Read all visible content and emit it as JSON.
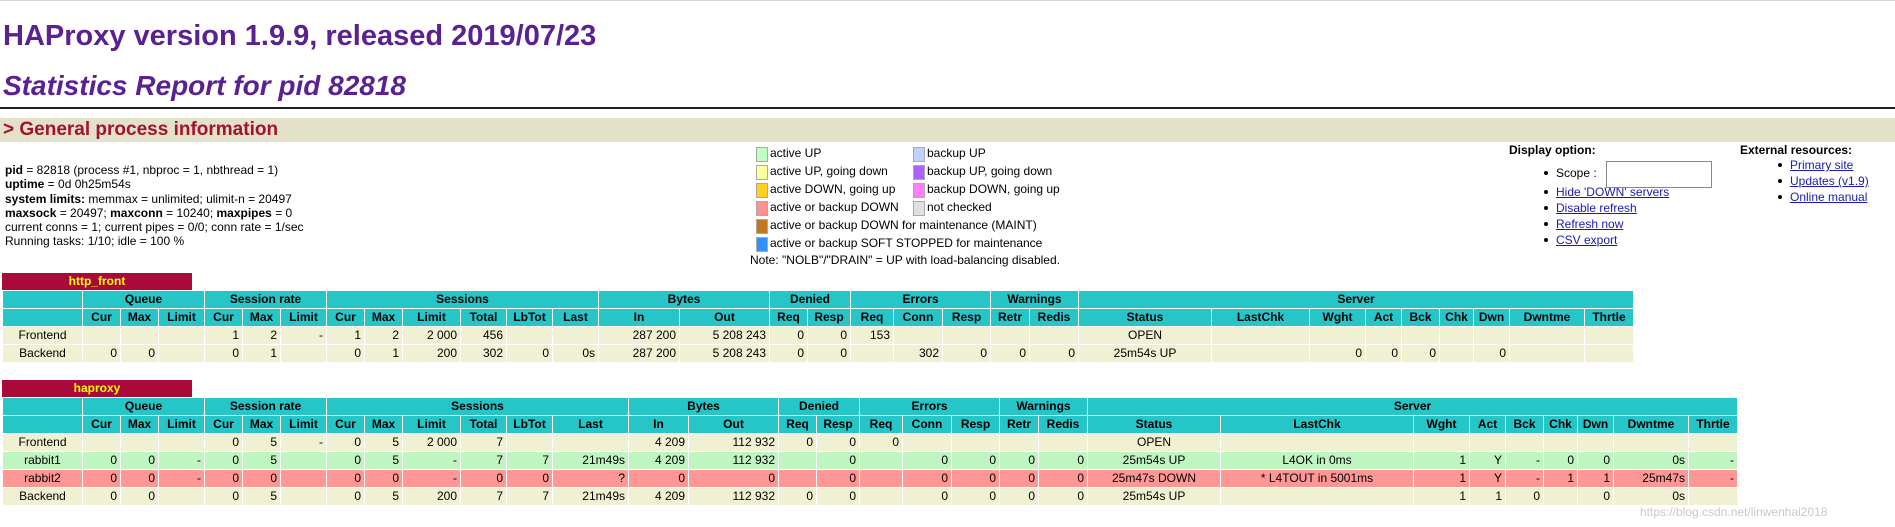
{
  "header": {
    "title": "HAProxy version 1.9.9, released 2019/07/23",
    "subtitle": "Statistics Report for pid 82818"
  },
  "section": {
    "title": "> General process information"
  },
  "info": {
    "line1_label": "pid",
    "line1_value": " = 82818 (process #1, nbproc = 1, nbthread = 1)",
    "line2_label": "uptime",
    "line2_value": " = 0d 0h25m54s",
    "line3_label": "system limits:",
    "line3_value": " memmax = unlimited; ulimit-n = 20497",
    "line4_label_a": "maxsock",
    "line4_value_a": " = 20497; ",
    "line4_label_b": "maxconn",
    "line4_value_b": " = 10240; ",
    "line4_label_c": "maxpipes",
    "line4_value_c": " = 0",
    "line5": "current conns = 1; current pipes = 0/0; conn rate = 1/sec",
    "line6": "Running tasks: 1/10; idle = 100 %"
  },
  "legend": {
    "items": [
      {
        "label": "active UP",
        "color": "#c0ffc0"
      },
      {
        "label": "active UP, going down",
        "color": "#ffffa0"
      },
      {
        "label": "active DOWN, going up",
        "color": "#ffd020"
      },
      {
        "label": "active or backup DOWN",
        "color": "#ff9090"
      },
      {
        "label": "active or backup DOWN for maintenance (MAINT)",
        "color": "#c07820"
      },
      {
        "label": "active or backup SOFT STOPPED for maintenance",
        "color": "#3090ff"
      },
      {
        "label": "backup UP",
        "color": "#c0d0ff"
      },
      {
        "label": "backup UP, going down",
        "color": "#b060ff"
      },
      {
        "label": "backup DOWN, going up",
        "color": "#ff80ff"
      },
      {
        "label": "not checked",
        "color": "#e0e0e0"
      }
    ],
    "note": "Note: \"NOLB\"/\"DRAIN\" = UP with load-balancing disabled."
  },
  "display": {
    "title": "Display option:",
    "scope_label": "Scope :",
    "links": [
      "Hide 'DOWN' servers",
      "Disable refresh",
      "Refresh now",
      "CSV export"
    ]
  },
  "external": {
    "title": "External resources:",
    "links": [
      "Primary site",
      "Updates (v1.9)",
      "Online manual"
    ]
  },
  "headers": {
    "groups": [
      "Queue",
      "Session rate",
      "Sessions",
      "Bytes",
      "Denied",
      "Errors",
      "Warnings",
      "Server"
    ],
    "cols": [
      "Cur",
      "Max",
      "Limit",
      "Cur",
      "Max",
      "Limit",
      "Cur",
      "Max",
      "Limit",
      "Total",
      "LbTot",
      "Last",
      "In",
      "Out",
      "Req",
      "Resp",
      "Req",
      "Conn",
      "Resp",
      "Retr",
      "Redis",
      "Status",
      "LastChk",
      "Wght",
      "Act",
      "Bck",
      "Chk",
      "Dwn",
      "Dwntme",
      "Thrtle"
    ]
  },
  "http_front": {
    "name": "http_front",
    "rows": [
      {
        "kind": "frontend",
        "cells": [
          "Frontend",
          "",
          "",
          "",
          "1",
          "2",
          "-",
          "1",
          "2",
          "2 000",
          "456",
          "",
          "",
          "287 200",
          "5 208 243",
          "0",
          "0",
          "153",
          "",
          "",
          "",
          "",
          "OPEN",
          "",
          "",
          "",
          "",
          "",
          "",
          "",
          ""
        ]
      },
      {
        "kind": "backend",
        "cells": [
          "Backend",
          "0",
          "0",
          "",
          "0",
          "1",
          "",
          "0",
          "1",
          "200",
          "302",
          "0",
          "0s",
          "287 200",
          "5 208 243",
          "0",
          "0",
          "",
          "302",
          "0",
          "0",
          "0",
          "25m54s UP",
          "",
          "0",
          "0",
          "0",
          "",
          "0",
          "",
          ""
        ]
      }
    ]
  },
  "haproxy": {
    "name": "haproxy",
    "rows": [
      {
        "kind": "frontend",
        "cells": [
          "Frontend",
          "",
          "",
          "",
          "0",
          "5",
          "-",
          "0",
          "5",
          "2 000",
          "7",
          "",
          "",
          "4 209",
          "112 932",
          "0",
          "0",
          "0",
          "",
          "",
          "",
          "",
          "OPEN",
          "",
          "",
          "",
          "",
          "",
          "",
          "",
          ""
        ]
      },
      {
        "kind": "up",
        "cells": [
          "rabbit1",
          "0",
          "0",
          "-",
          "0",
          "5",
          "",
          "0",
          "5",
          "-",
          "7",
          "7",
          "21m49s",
          "4 209",
          "112 932",
          "",
          "0",
          "",
          "0",
          "0",
          "0",
          "0",
          "25m54s UP",
          "L4OK in 0ms",
          "1",
          "Y",
          "-",
          "0",
          "0",
          "0s",
          "-"
        ]
      },
      {
        "kind": "down",
        "cells": [
          "rabbit2",
          "0",
          "0",
          "-",
          "0",
          "0",
          "",
          "0",
          "0",
          "-",
          "0",
          "0",
          "?",
          "0",
          "0",
          "",
          "0",
          "",
          "0",
          "0",
          "0",
          "0",
          "25m47s DOWN",
          "* L4TOUT in 5001ms",
          "1",
          "Y",
          "-",
          "1",
          "1",
          "25m47s",
          "-"
        ]
      },
      {
        "kind": "backend",
        "cells": [
          "Backend",
          "0",
          "0",
          "",
          "0",
          "5",
          "",
          "0",
          "5",
          "200",
          "7",
          "7",
          "21m49s",
          "4 209",
          "112 932",
          "0",
          "0",
          "",
          "0",
          "0",
          "0",
          "0",
          "25m54s UP",
          "",
          "1",
          "1",
          "0",
          "",
          "0",
          "0s",
          ""
        ]
      }
    ]
  },
  "watermark": "https://blog.csdn.net/linwenhai2018"
}
